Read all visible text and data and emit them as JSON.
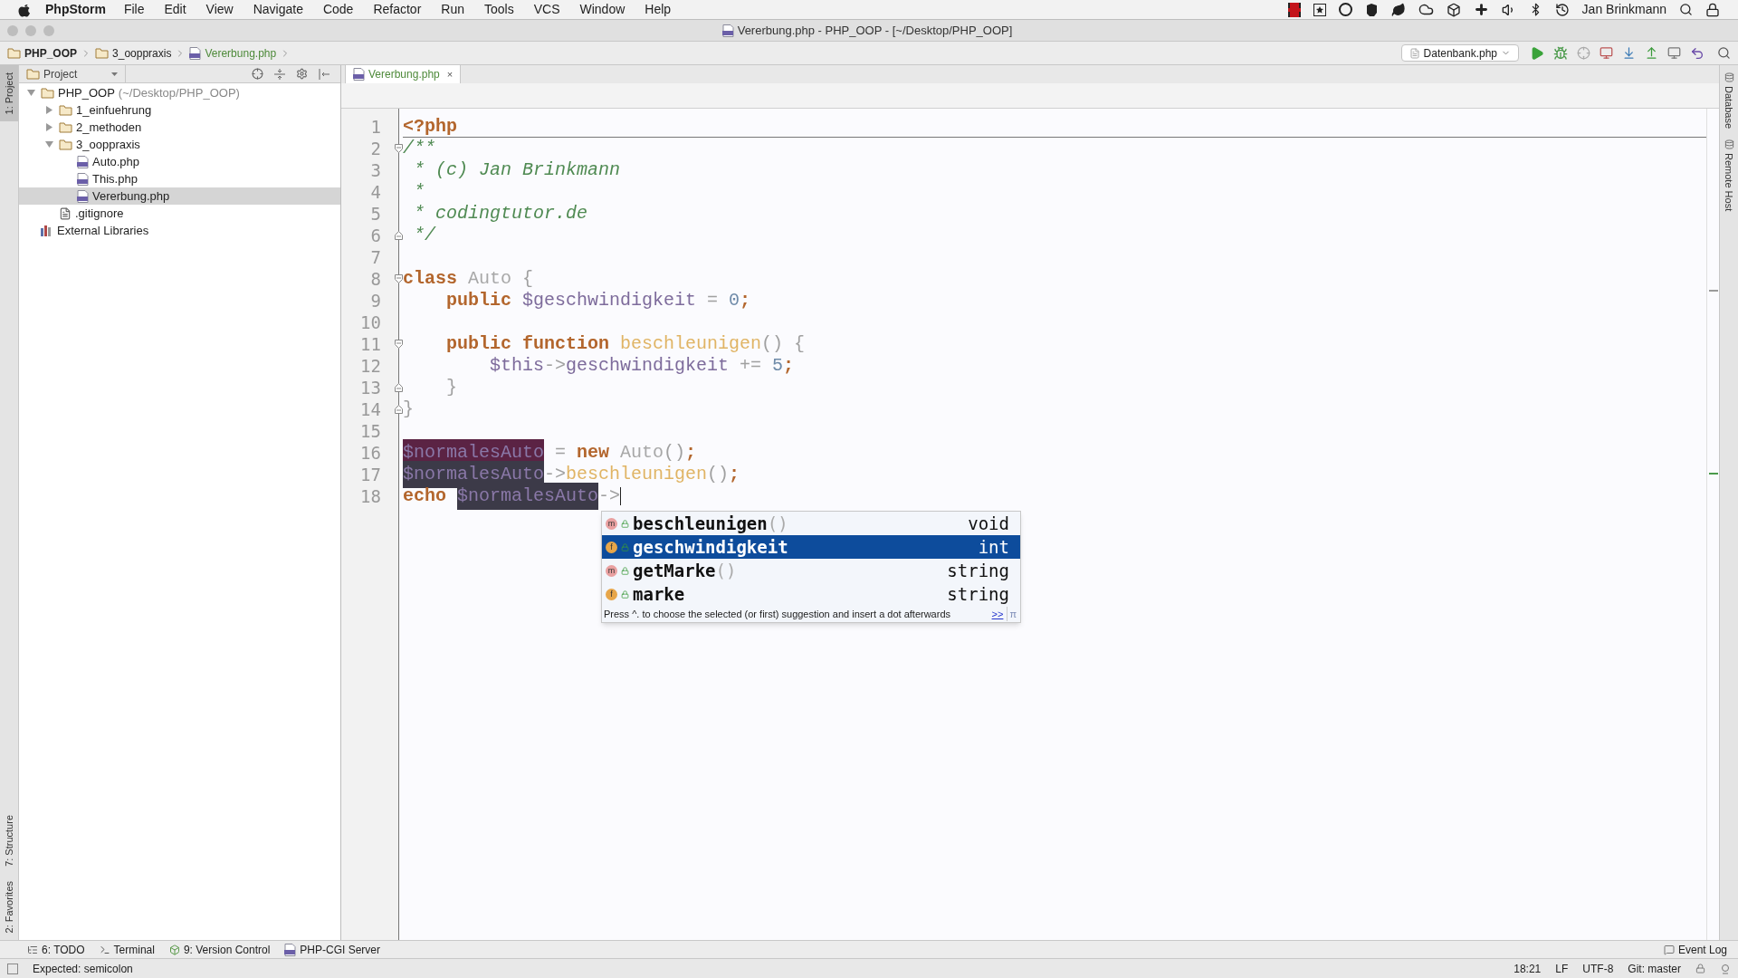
{
  "menu_bar": {
    "app": "PhpStorm",
    "items": [
      "File",
      "Edit",
      "View",
      "Navigate",
      "Code",
      "Refactor",
      "Run",
      "Tools",
      "VCS",
      "Window",
      "Help"
    ],
    "user": "Jan Brinkmann"
  },
  "window": {
    "title": "Vererbung.php - PHP_OOP - [~/Desktop/PHP_OOP]"
  },
  "breadcrumbs": [
    {
      "label": "PHP_OOP",
      "kind": "folder"
    },
    {
      "label": "3_ooppraxis",
      "kind": "folder"
    },
    {
      "label": "Vererbung.php",
      "kind": "file"
    }
  ],
  "run_config": {
    "label": "Datenbank.php"
  },
  "left_tool_tabs": [
    {
      "label": "1: Project",
      "selected": true
    },
    {
      "label": "7: Structure",
      "selected": false
    },
    {
      "label": "2: Favorites",
      "selected": false
    }
  ],
  "right_tool_tabs": [
    "Database",
    "Remote Host"
  ],
  "project_panel": {
    "view": "Project",
    "tree": [
      {
        "label": "PHP_OOP",
        "path": "(~/Desktop/PHP_OOP)",
        "kind": "folder",
        "expanded": true,
        "selected": false,
        "children": [
          {
            "label": "1_einfuehrung",
            "kind": "folder",
            "expanded": false,
            "selected": false
          },
          {
            "label": "2_methoden",
            "kind": "folder",
            "expanded": false,
            "selected": false
          },
          {
            "label": "3_ooppraxis",
            "kind": "folder",
            "expanded": true,
            "selected": false,
            "children": [
              {
                "label": "Auto.php",
                "kind": "php",
                "selected": false
              },
              {
                "label": "This.php",
                "kind": "php",
                "selected": false
              },
              {
                "label": "Vererbung.php",
                "kind": "php",
                "selected": true
              }
            ]
          },
          {
            "label": ".gitignore",
            "kind": "text",
            "selected": false
          }
        ]
      },
      {
        "label": "External Libraries",
        "kind": "library",
        "selected": false
      }
    ]
  },
  "editor_tabs": [
    {
      "label": "Vererbung.php",
      "close": "×",
      "selected": true
    }
  ],
  "code": [
    {
      "number": "1",
      "tokens": [
        {
          "text": "<?php",
          "kind": "kw"
        }
      ]
    },
    {
      "number": "2",
      "fold_start": true,
      "tokens": [
        {
          "text": "/**",
          "kind": "comment"
        }
      ]
    },
    {
      "number": "3",
      "tokens": [
        {
          "text": " * (c) Jan Brinkmann",
          "kind": "comment"
        }
      ]
    },
    {
      "number": "4",
      "tokens": [
        {
          "text": " *",
          "kind": "comment"
        }
      ]
    },
    {
      "number": "5",
      "tokens": [
        {
          "text": " * codingtutor.de",
          "kind": "comment"
        }
      ]
    },
    {
      "number": "6",
      "fold_end": true,
      "tokens": [
        {
          "text": " */",
          "kind": "comment"
        }
      ]
    },
    {
      "number": "7"
    },
    {
      "number": "8",
      "fold_start": true,
      "tokens": [
        {
          "text": "class",
          "kind": "kw"
        },
        {
          "text": " Auto",
          "kind": "cls"
        },
        {
          "text": " {",
          "kind": "op"
        }
      ]
    },
    {
      "number": "9",
      "tokens": [
        {
          "text": "    public",
          "kind": "kw"
        },
        {
          "text": " $geschwindigkeit",
          "kind": "var"
        },
        {
          "text": " =",
          "kind": "op"
        },
        {
          "text": " 0",
          "kind": "num"
        },
        {
          "text": ";",
          "kind": "kw"
        }
      ]
    },
    {
      "number": "10"
    },
    {
      "number": "11",
      "fold_start": true,
      "tokens": [
        {
          "text": "    public function",
          "kind": "kw"
        },
        {
          "text": " beschleunigen",
          "kind": "fn"
        },
        {
          "text": "() {",
          "kind": "op"
        }
      ]
    },
    {
      "number": "12",
      "tokens": [
        {
          "text": "        $this",
          "kind": "var"
        },
        {
          "text": "->",
          "kind": "op"
        },
        {
          "text": "geschwindigkeit",
          "kind": "var"
        },
        {
          "text": " +=",
          "kind": "op"
        },
        {
          "text": " 5",
          "kind": "num"
        },
        {
          "text": ";",
          "kind": "kw"
        }
      ]
    },
    {
      "number": "13",
      "fold_end": true,
      "tokens": [
        {
          "text": "    }",
          "kind": "op"
        }
      ]
    },
    {
      "number": "14",
      "fold_end": true,
      "tokens": [
        {
          "text": "}",
          "kind": "op"
        }
      ]
    },
    {
      "number": "15"
    },
    {
      "number": "16",
      "tokens": [
        {
          "text": "$normalesAuto",
          "kind": "var_write"
        },
        {
          "text": " =",
          "kind": "op"
        },
        {
          "text": " new",
          "kind": "kw"
        },
        {
          "text": " Auto",
          "kind": "cls"
        },
        {
          "text": "()",
          "kind": "op"
        },
        {
          "text": ";",
          "kind": "kw"
        }
      ]
    },
    {
      "number": "17",
      "tokens": [
        {
          "text": "$normalesAuto",
          "kind": "var_read"
        },
        {
          "text": "->",
          "kind": "op"
        },
        {
          "text": "beschleunigen",
          "kind": "fn"
        },
        {
          "text": "()",
          "kind": "op"
        },
        {
          "text": ";",
          "kind": "kw"
        }
      ]
    },
    {
      "number": "18",
      "caret": true,
      "tokens": [
        {
          "text": "echo ",
          "kind": "kw"
        },
        {
          "text": "$normalesAuto",
          "kind": "var_read"
        },
        {
          "text": "->",
          "kind": "op"
        }
      ]
    }
  ],
  "completion": {
    "items": [
      {
        "badge": "m",
        "kind": "method",
        "name": "beschleunigen",
        "params": "()",
        "type": "void",
        "selected": false
      },
      {
        "badge": "f",
        "kind": "field",
        "name": "geschwindigkeit",
        "type": "int",
        "selected": true
      },
      {
        "badge": "m",
        "kind": "method",
        "name": "getMarke",
        "params": "()",
        "type": "string",
        "selected": false
      },
      {
        "badge": "f",
        "kind": "field",
        "name": "marke",
        "type": "string",
        "selected": false
      }
    ],
    "hint": "Press ^. to choose the selected (or first) suggestion and insert a dot afterwards",
    "more_link": ">>",
    "pin": "π"
  },
  "tool_buttons": [
    {
      "label": "6: TODO",
      "kind": "todo"
    },
    {
      "label": "Terminal",
      "kind": "terminal"
    },
    {
      "label": "9: Version Control",
      "kind": "vcs"
    },
    {
      "label": "PHP-CGI Server",
      "kind": "php"
    }
  ],
  "event_log": "Event Log",
  "status_bar": {
    "message": "Expected: semicolon",
    "position": "18:21",
    "line_separator": "LF",
    "encoding": "UTF-8",
    "branch": "Git: master"
  }
}
